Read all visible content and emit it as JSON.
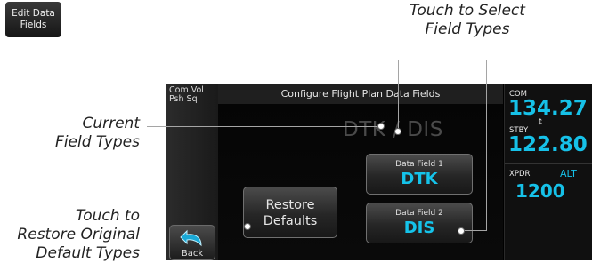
{
  "legend_button": {
    "line1": "Edit Data",
    "line2": "Fields"
  },
  "callouts": {
    "select_line1": "Touch to Select",
    "select_line2": "Field Types",
    "current_line1": "Current",
    "current_line2": "Field Types",
    "restore_line1": "Touch to",
    "restore_line2": "Restore Original",
    "restore_line3": "Default Types"
  },
  "screen": {
    "left_top_line1": "Com Vol",
    "left_top_line2": "Psh Sq",
    "title": "Configure Flight Plan Data Fields",
    "current_types": "DTK / DIS",
    "data_field_1": {
      "label": "Data Field 1",
      "value": "DTK"
    },
    "data_field_2": {
      "label": "Data Field 2",
      "value": "DIS"
    },
    "restore_line1": "Restore",
    "restore_line2": "Defaults",
    "back_label": "Back"
  },
  "radio": {
    "com_label": "COM",
    "com_freq": "134.27",
    "stby_label": "STBY",
    "stby_freq": "122.80",
    "xpdr_label": "XPDR",
    "xpdr_mode": "ALT",
    "xpdr_code": "1200"
  },
  "colors": {
    "accent_cyan": "#16c1e8",
    "callout_line": "#a5a5a5"
  }
}
